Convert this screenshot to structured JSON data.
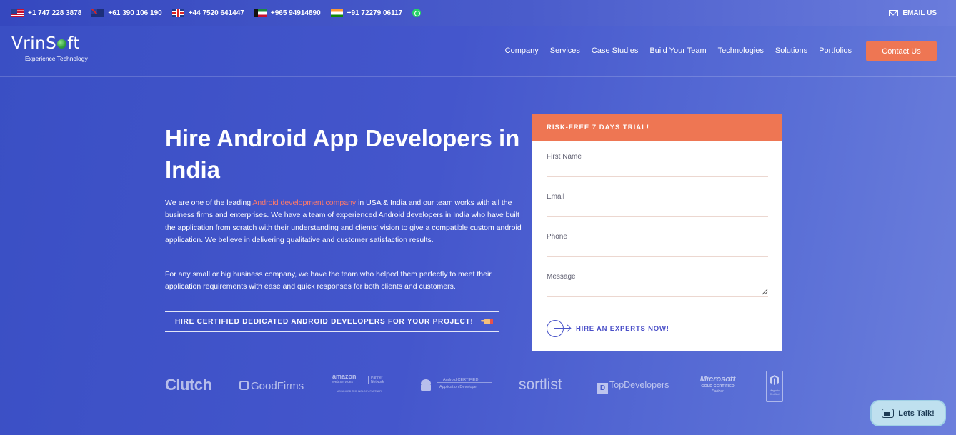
{
  "topbar": {
    "contacts": [
      {
        "flag": "us-flag",
        "phone": "+1 747 228 3878"
      },
      {
        "flag": "au-flag",
        "phone": "+61 390 106 190"
      },
      {
        "flag": "uk-flag",
        "phone": "+44 7520 641447"
      },
      {
        "flag": "kw-flag",
        "phone": "+965 94914890"
      },
      {
        "flag": "in-flag",
        "phone": "+91 72279 06117"
      }
    ],
    "email_label": "EMAIL US"
  },
  "brand": {
    "logo_text_a": "VrinS",
    "logo_text_b": "ft",
    "tagline": "Experience Technology"
  },
  "nav": {
    "items": [
      "Company",
      "Services",
      "Case Studies",
      "Build Your Team",
      "Technologies",
      "Solutions",
      "Portfolios"
    ],
    "contact_label": "Contact Us"
  },
  "hero": {
    "title": "Hire Android App Developers in India",
    "p1_before": "We are one of the leading ",
    "p1_link": "Android development company",
    "p1_after": " in USA & India and our team works with all the business firms and enterprises. We have a team of experienced Android developers in India who have built the application from scratch with their understanding and clients' vision to give a compatible custom android application. We believe in delivering qualitative and customer satisfaction results.",
    "p2": "For any small or big business company, we have the team who helped them perfectly to meet their application requirements with ease and quick responses for both clients and customers.",
    "cta": "HIRE CERTIFIED DEDICATED ANDROID DEVELOPERS FOR YOUR PROJECT!"
  },
  "form": {
    "header": "RISK-FREE 7 DAYS TRIAL!",
    "fields": [
      "First Name",
      "Email",
      "Phone",
      "Message"
    ],
    "submit": "HIRE AN EXPERTS NOW!"
  },
  "partners": {
    "clutch": "Clutch",
    "goodfirms": "GoodFirms",
    "aws_name": "amazon",
    "aws_sub": "web services",
    "aws_partner_a": "Partner",
    "aws_partner_b": "Network",
    "aws_caption": "ADVANCED TECHNOLOGY PARTNER",
    "android_line1": "Android CERTIFIED",
    "android_line2": "Application Developer",
    "sortlist": "sortlist",
    "topdevelopers": "TopDevelopers",
    "ms_name": "Microsoft",
    "ms_gold": "GOLD CERTIFIED",
    "ms_partner": "Partner",
    "magento_a": "Magento",
    "magento_b": "Certified"
  },
  "chat": {
    "label": "Lets Talk!"
  },
  "colors": {
    "accent": "#ee7653",
    "link_highlight": "#ff7a6a",
    "submit_text": "#4a4fc8",
    "chat_bg": "#bfe0ef"
  }
}
